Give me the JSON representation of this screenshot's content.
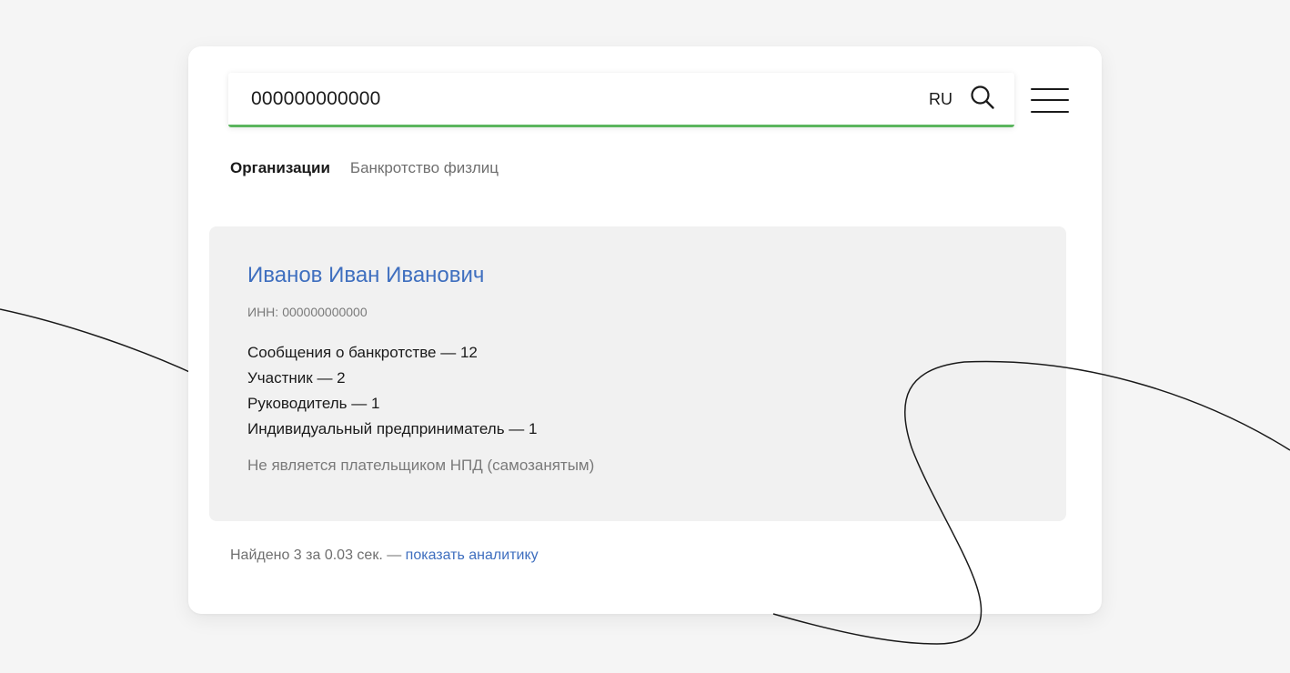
{
  "search": {
    "value": "000000000000",
    "language": "RU"
  },
  "icons": {
    "search": "search-icon",
    "menu": "hamburger-menu-icon"
  },
  "tabs": [
    {
      "label": "Организации",
      "active": true
    },
    {
      "label": "Банкротство физлиц",
      "active": false
    }
  ],
  "result": {
    "name": "Иванов Иван Иванович",
    "inn_label": "ИНН:",
    "inn_value": "000000000000",
    "stats": [
      "Сообщения о банкротстве — 12",
      "Участник — 2",
      "Руководитель — 1",
      "Индивидуальный предприниматель — 1"
    ],
    "npd_status": "Не является плательщиком НПД (самозанятым)"
  },
  "footer": {
    "found_text": "Найдено 3 за 0.03 сек. — ",
    "analytics_link": "показать аналитику"
  },
  "colors": {
    "accent_green": "#5bb55e",
    "link_blue": "#3f6fbf",
    "background": "#f5f5f5",
    "result_card_bg": "#f1f1f1"
  }
}
